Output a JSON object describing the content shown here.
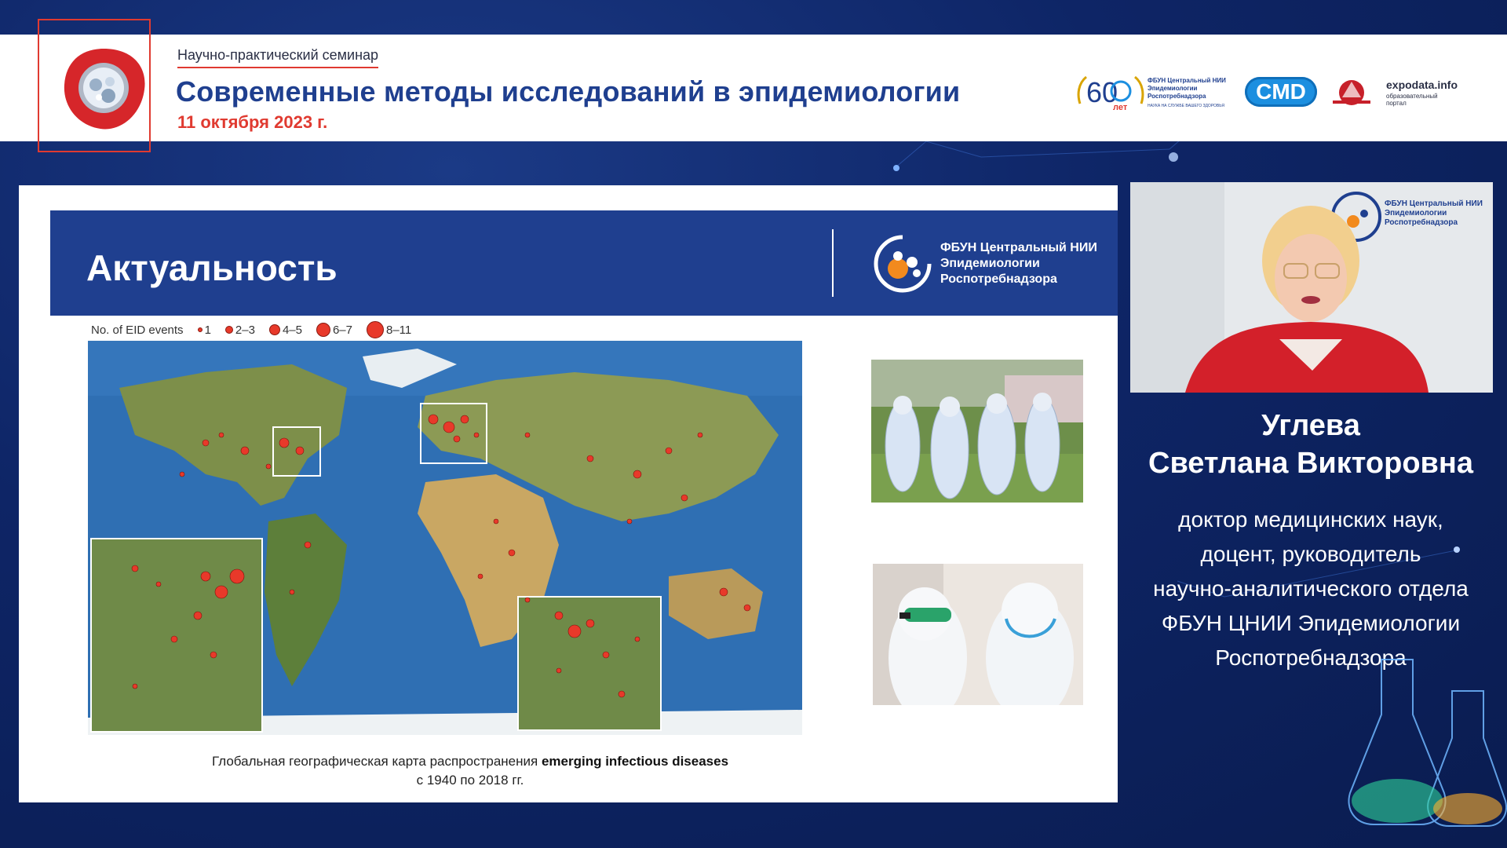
{
  "header": {
    "subtitle": "Научно-практический семинар",
    "title": "Современные методы исследований в эпидемиологии",
    "date": "11 октября 2023 г."
  },
  "partners": {
    "anniversary": {
      "number": "60",
      "word": "лет",
      "name": "ФБУН Центральный НИИ Эпидемиологии Роспотребнадзора",
      "motto": "НАУКА НА СЛУЖБЕ ВАШЕГО ЗДОРОВЬЯ"
    },
    "cmd": "CMD",
    "expodata": {
      "name": "expodata.info",
      "tagline": "образовательный портал"
    }
  },
  "slide": {
    "title": "Актуальность",
    "institute": [
      "ФБУН Центральный НИИ",
      "Эпидемиологии",
      "Роспотребнадзора"
    ],
    "legend": {
      "title": "No. of EID events",
      "items": [
        "1",
        "2–3",
        "4–5",
        "6–7",
        "8–11"
      ]
    },
    "caption_line1_prefix": "Глобальная географическая карта распространения ",
    "caption_line1_bold": "emerging infectious diseases",
    "caption_line2": "с 1940 по 2018 гг."
  },
  "speaker": {
    "surname": "Углева",
    "given": "Светлана Викторовна",
    "role_lines": [
      "доктор медицинских наук,",
      "доцент, руководитель",
      "научно-аналитического отдела",
      "ФБУН ЦНИИ Эпидемиологии",
      "Роспотребнадзора"
    ],
    "backdrop_text": [
      "ФБУН Центральный НИИ",
      "Эпидемиологии",
      "Роспотребнадзора"
    ]
  },
  "colors": {
    "brand_blue": "#1f3f8f",
    "accent_red": "#e03a30",
    "bg_dark": "#0e2566",
    "dot_red": "#e8392a"
  }
}
